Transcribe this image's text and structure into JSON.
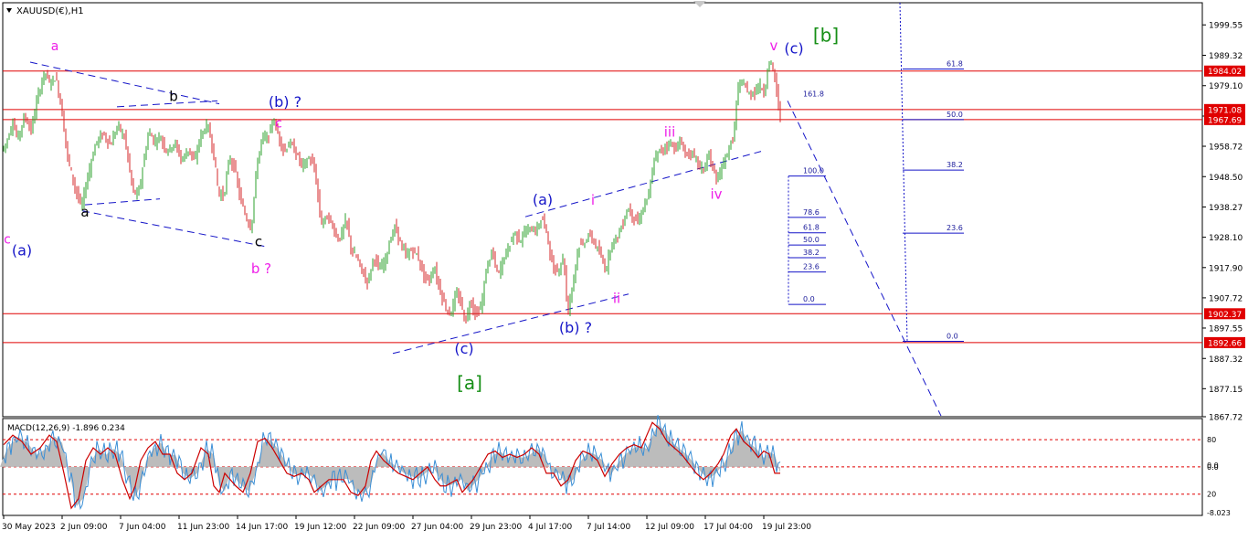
{
  "window": {
    "symbol_title": "XAUUSD(€),H1"
  },
  "colors": {
    "background": "#ffffff",
    "bull": "#2ca02c",
    "bear": "#d62728",
    "level_line": "#e00000",
    "price_tag_bg": "#e00000",
    "blue": "#1515c8",
    "magenta": "#ee1ee8",
    "green": "#168f16",
    "black": "#000000",
    "fib_text": "#1a1a9a",
    "macd_hist": "#bcbcbc",
    "macd_signal": "#cc0000",
    "macd_main": "#3b8fd6"
  },
  "chart_data": [
    {
      "type": "candlestick",
      "timeframe": "H1",
      "ylim": [
        1867.72,
        2007
      ],
      "y_ticks": [
        1999.55,
        1989.32,
        1979.1,
        1968.87,
        1958.72,
        1948.5,
        1938.27,
        1928.1,
        1917.9,
        1907.72,
        1897.55,
        1887.32,
        1877.15,
        1867.72
      ],
      "x_tick_labels": [
        "30 May 2023",
        "2 Jun 09:00",
        "7 Jun 04:00",
        "11 Jun 23:00",
        "14 Jun 17:00",
        "19 Jun 12:00",
        "22 Jun 09:00",
        "27 Jun 04:00",
        "29 Jun 23:00",
        "4 Jul 17:00",
        "7 Jul 14:00",
        "12 Jul 09:00",
        "17 Jul 04:00",
        "19 Jul 23:00"
      ],
      "price_path": [
        [
          0,
          1956
        ],
        [
          8,
          1960
        ],
        [
          15,
          1967
        ],
        [
          20,
          1961
        ],
        [
          28,
          1969
        ],
        [
          35,
          1964
        ],
        [
          42,
          1975
        ],
        [
          50,
          1984
        ],
        [
          55,
          1980
        ],
        [
          62,
          1982
        ],
        [
          68,
          1972
        ],
        [
          75,
          1955
        ],
        [
          82,
          1946
        ],
        [
          90,
          1938
        ],
        [
          98,
          1950
        ],
        [
          106,
          1960
        ],
        [
          114,
          1963
        ],
        [
          122,
          1959
        ],
        [
          130,
          1966
        ],
        [
          138,
          1961
        ],
        [
          146,
          1944
        ],
        [
          152,
          1942
        ],
        [
          158,
          1953
        ],
        [
          164,
          1964
        ],
        [
          170,
          1960
        ],
        [
          176,
          1962
        ],
        [
          184,
          1957
        ],
        [
          192,
          1960
        ],
        [
          200,
          1954
        ],
        [
          208,
          1958
        ],
        [
          214,
          1953
        ],
        [
          220,
          1962
        ],
        [
          228,
          1966
        ],
        [
          234,
          1958
        ],
        [
          240,
          1943
        ],
        [
          246,
          1942
        ],
        [
          252,
          1955
        ],
        [
          258,
          1951
        ],
        [
          264,
          1941
        ],
        [
          270,
          1935
        ],
        [
          276,
          1931
        ],
        [
          282,
          1952
        ],
        [
          288,
          1962
        ],
        [
          294,
          1961
        ],
        [
          300,
          1968
        ],
        [
          306,
          1962
        ],
        [
          312,
          1957
        ],
        [
          318,
          1960
        ],
        [
          324,
          1957
        ],
        [
          332,
          1952
        ],
        [
          340,
          1955
        ],
        [
          346,
          1950
        ],
        [
          352,
          1933
        ],
        [
          360,
          1935
        ],
        [
          366,
          1931
        ],
        [
          372,
          1927
        ],
        [
          380,
          1934
        ],
        [
          386,
          1923
        ],
        [
          392,
          1921
        ],
        [
          398,
          1916
        ],
        [
          404,
          1913
        ],
        [
          410,
          1922
        ],
        [
          416,
          1917
        ],
        [
          422,
          1920
        ],
        [
          428,
          1927
        ],
        [
          434,
          1932
        ],
        [
          440,
          1925
        ],
        [
          446,
          1922
        ],
        [
          452,
          1924
        ],
        [
          458,
          1922
        ],
        [
          464,
          1916
        ],
        [
          470,
          1913
        ],
        [
          476,
          1918
        ],
        [
          482,
          1911
        ],
        [
          488,
          1905
        ],
        [
          494,
          1902
        ],
        [
          500,
          1909
        ],
        [
          506,
          1906
        ],
        [
          510,
          1899
        ],
        [
          516,
          1907
        ],
        [
          522,
          1902
        ],
        [
          528,
          1905
        ],
        [
          534,
          1919
        ],
        [
          540,
          1923
        ],
        [
          546,
          1915
        ],
        [
          552,
          1921
        ],
        [
          558,
          1925
        ],
        [
          564,
          1930
        ],
        [
          570,
          1927
        ],
        [
          576,
          1930
        ],
        [
          582,
          1931
        ],
        [
          588,
          1930
        ],
        [
          594,
          1935
        ],
        [
          600,
          1929
        ],
        [
          606,
          1917
        ],
        [
          612,
          1917
        ],
        [
          618,
          1922
        ],
        [
          622,
          1902
        ],
        [
          628,
          1913
        ],
        [
          634,
          1925
        ],
        [
          640,
          1926
        ],
        [
          646,
          1929
        ],
        [
          652,
          1926
        ],
        [
          658,
          1922
        ],
        [
          664,
          1917
        ],
        [
          670,
          1926
        ],
        [
          676,
          1928
        ],
        [
          682,
          1932
        ],
        [
          688,
          1938
        ],
        [
          694,
          1935
        ],
        [
          700,
          1933
        ],
        [
          706,
          1939
        ],
        [
          712,
          1943
        ],
        [
          716,
          1953
        ],
        [
          722,
          1957
        ],
        [
          728,
          1958
        ],
        [
          734,
          1960
        ],
        [
          740,
          1958
        ],
        [
          746,
          1960
        ],
        [
          752,
          1956
        ],
        [
          758,
          1956
        ],
        [
          764,
          1954
        ],
        [
          770,
          1950
        ],
        [
          776,
          1956
        ],
        [
          782,
          1951
        ],
        [
          786,
          1946
        ],
        [
          792,
          1953
        ],
        [
          798,
          1957
        ],
        [
          804,
          1962
        ],
        [
          808,
          1977
        ],
        [
          814,
          1981
        ],
        [
          820,
          1976
        ],
        [
          826,
          1977
        ],
        [
          832,
          1979
        ],
        [
          838,
          1977
        ],
        [
          842,
          1987
        ],
        [
          846,
          1986
        ],
        [
          850,
          1980
        ],
        [
          854,
          1969
        ]
      ],
      "levels": [
        1984.02,
        1971.08,
        1967.69,
        1902.37,
        1892.66
      ],
      "price_tags": [
        "1984.02",
        "1971.08",
        "1967.69",
        "1902.37",
        "1892.66"
      ],
      "wave_labels": [
        {
          "text": "a",
          "price": 1991,
          "bar": 60,
          "color": "magenta",
          "size": 14
        },
        {
          "text": "b",
          "price": 1974,
          "bar": 190,
          "color": "black",
          "size": 15
        },
        {
          "text": "(b) ?",
          "price": 1972,
          "bar": 312,
          "color": "blue",
          "size": 16
        },
        {
          "text": "c",
          "price": 1965,
          "bar": 305,
          "color": "magenta",
          "size": 14
        },
        {
          "text": "a",
          "price": 1935,
          "bar": 93,
          "color": "black",
          "size": 15
        },
        {
          "text": "c",
          "price": 1925,
          "bar": 283,
          "color": "black",
          "size": 15
        },
        {
          "text": "b ?",
          "price": 1916,
          "bar": 286,
          "color": "magenta",
          "size": 15
        },
        {
          "text": "c",
          "price": 1926,
          "bar": 8,
          "color": "magenta",
          "size": 14
        },
        {
          "text": "(a)",
          "price": 1922,
          "bar": 24,
          "color": "blue",
          "size": 16
        },
        {
          "text": "(c)",
          "price": 1889,
          "bar": 508,
          "color": "blue",
          "size": 16
        },
        {
          "text": "[a]",
          "price": 1877,
          "bar": 514,
          "color": "green",
          "size": 20
        },
        {
          "text": "(a)",
          "price": 1939,
          "bar": 594,
          "color": "blue",
          "size": 16
        },
        {
          "text": "i",
          "price": 1939,
          "bar": 649,
          "color": "magenta",
          "size": 15
        },
        {
          "text": "(b) ?",
          "price": 1896,
          "bar": 630,
          "color": "blue",
          "size": 16
        },
        {
          "text": "ii",
          "price": 1906,
          "bar": 675,
          "color": "magenta",
          "size": 15
        },
        {
          "text": "iii",
          "price": 1962,
          "bar": 733,
          "color": "magenta",
          "size": 15
        },
        {
          "text": "iv",
          "price": 1941,
          "bar": 784,
          "color": "magenta",
          "size": 15
        },
        {
          "text": "v",
          "price": 1991,
          "bar": 847,
          "color": "magenta",
          "size": 15
        },
        {
          "text": "(c)",
          "price": 1990,
          "bar": 869,
          "color": "blue",
          "size": 16
        },
        {
          "text": "[b]",
          "price": 1994,
          "bar": 904,
          "color": "green",
          "size": 20
        }
      ],
      "fib_right": [
        {
          "label": "61.8",
          "price": 1984.7
        },
        {
          "label": "50.0",
          "price": 1967.7
        },
        {
          "label": "38.2",
          "price": 1950.7
        },
        {
          "label": "23.6",
          "price": 1929.5
        },
        {
          "label": "0.0",
          "price": 1893.1
        }
      ],
      "fib_right_extra": {
        "label": "161.8",
        "price": 1974.6
      },
      "fib_small": [
        {
          "label": "100.0",
          "price": 1948.7
        },
        {
          "label": "78.6",
          "price": 1934.8
        },
        {
          "label": "61.8",
          "price": 1929.6
        },
        {
          "label": "50.0",
          "price": 1925.5
        },
        {
          "label": "38.2",
          "price": 1921.2
        },
        {
          "label": "23.6",
          "price": 1916.4
        },
        {
          "label": "0.0",
          "price": 1905.5
        }
      ]
    },
    {
      "type": "macd",
      "title": "MACD(12,26,9) -1.896 0.234",
      "ylim": [
        -8.023,
        8.0
      ],
      "y_ticks": [
        "80",
        "0.0",
        "20",
        "-8.023"
      ],
      "label_3_9": "0.0",
      "histogram_path": [
        [
          0,
          0.5
        ],
        [
          10,
          3.5
        ],
        [
          20,
          5
        ],
        [
          30,
          4
        ],
        [
          40,
          2
        ],
        [
          50,
          3
        ],
        [
          60,
          5
        ],
        [
          68,
          4
        ],
        [
          76,
          -1
        ],
        [
          84,
          -6.5
        ],
        [
          92,
          -5
        ],
        [
          100,
          1
        ],
        [
          108,
          3
        ],
        [
          116,
          2
        ],
        [
          124,
          3
        ],
        [
          132,
          2
        ],
        [
          140,
          -2
        ],
        [
          148,
          -5
        ],
        [
          154,
          -3
        ],
        [
          160,
          1
        ],
        [
          168,
          3
        ],
        [
          176,
          4
        ],
        [
          184,
          2
        ],
        [
          192,
          2
        ],
        [
          200,
          -1
        ],
        [
          208,
          -2
        ],
        [
          216,
          -1
        ],
        [
          226,
          3
        ],
        [
          234,
          2
        ],
        [
          240,
          -3
        ],
        [
          246,
          -4
        ],
        [
          252,
          -1
        ],
        [
          258,
          -2
        ],
        [
          264,
          -3
        ],
        [
          272,
          -4
        ],
        [
          280,
          -1
        ],
        [
          288,
          4
        ],
        [
          296,
          4.5
        ],
        [
          304,
          3
        ],
        [
          312,
          1
        ],
        [
          320,
          -1
        ],
        [
          328,
          -1.5
        ],
        [
          336,
          -1
        ],
        [
          344,
          -2
        ],
        [
          350,
          -4
        ],
        [
          358,
          -3
        ],
        [
          366,
          -2
        ],
        [
          374,
          -2
        ],
        [
          382,
          -2
        ],
        [
          390,
          -4
        ],
        [
          398,
          -4.5
        ],
        [
          406,
          -3
        ],
        [
          412,
          1
        ],
        [
          418,
          2.5
        ],
        [
          426,
          1
        ],
        [
          434,
          0
        ],
        [
          442,
          -1
        ],
        [
          450,
          -1.5
        ],
        [
          458,
          -2
        ],
        [
          466,
          -1
        ],
        [
          474,
          0
        ],
        [
          482,
          -2
        ],
        [
          488,
          -3
        ],
        [
          494,
          -3
        ],
        [
          500,
          -2.5
        ],
        [
          506,
          -2
        ],
        [
          512,
          -4
        ],
        [
          518,
          -3
        ],
        [
          524,
          -2
        ],
        [
          532,
          0
        ],
        [
          540,
          2
        ],
        [
          548,
          2.5
        ],
        [
          556,
          1.5
        ],
        [
          564,
          2
        ],
        [
          572,
          1.5
        ],
        [
          580,
          2
        ],
        [
          588,
          3
        ],
        [
          596,
          2
        ],
        [
          604,
          -1
        ],
        [
          612,
          -1
        ],
        [
          620,
          -3
        ],
        [
          628,
          -2
        ],
        [
          636,
          1
        ],
        [
          644,
          2.5
        ],
        [
          652,
          2
        ],
        [
          660,
          1
        ],
        [
          668,
          -1.5
        ],
        [
          676,
          0.5
        ],
        [
          684,
          2
        ],
        [
          692,
          3
        ],
        [
          700,
          3.5
        ],
        [
          708,
          3
        ],
        [
          714,
          5
        ],
        [
          720,
          7
        ],
        [
          728,
          6
        ],
        [
          736,
          4
        ],
        [
          744,
          3
        ],
        [
          752,
          2
        ],
        [
          760,
          0.5
        ],
        [
          768,
          -1
        ],
        [
          776,
          -2
        ],
        [
          784,
          -1
        ],
        [
          792,
          0.5
        ],
        [
          798,
          2
        ],
        [
          806,
          5
        ],
        [
          812,
          6
        ],
        [
          820,
          4
        ],
        [
          828,
          3
        ],
        [
          836,
          1.5
        ],
        [
          842,
          2.5
        ],
        [
          848,
          2
        ],
        [
          854,
          -1
        ]
      ]
    }
  ]
}
